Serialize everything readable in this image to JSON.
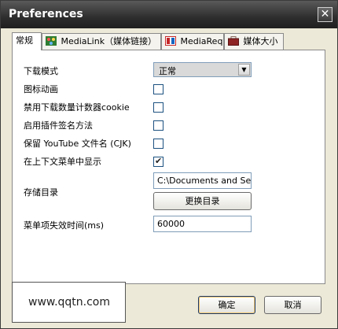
{
  "window": {
    "title": "Preferences",
    "close_glyph": "✕"
  },
  "tabs": [
    {
      "label": "常规",
      "icon": "none"
    },
    {
      "label": "MediaLink（媒体链接）",
      "icon": "network-icon"
    },
    {
      "label": "MediaReq",
      "icon": "film-icon"
    },
    {
      "label": "媒体大小",
      "icon": "briefcase-icon"
    }
  ],
  "general": {
    "download_mode": {
      "label": "下载模式",
      "value": "正常"
    },
    "icon_animation": {
      "label": "图标动画",
      "checked": false
    },
    "disable_cookie": {
      "label": "禁用下载数量计数器cookie",
      "checked": false
    },
    "plugin_signature": {
      "label": "启用插件签名方法",
      "checked": false
    },
    "youtube_filename": {
      "label": "保留 YouTube 文件名 (CJK)",
      "checked": false
    },
    "context_menu": {
      "label": "在上下文菜单中显示",
      "checked": true,
      "check_glyph": "✔"
    },
    "storage_dir": {
      "label": "存储目录",
      "value": "C:\\Documents and Se",
      "change_button": "更换目录"
    },
    "menu_timeout": {
      "label": "菜单项失效时间(ms)",
      "value": "60000"
    }
  },
  "footer": {
    "ok_button": "确定",
    "cancel_button": "取消"
  },
  "watermark": {
    "text": "www.qqtn.com"
  }
}
